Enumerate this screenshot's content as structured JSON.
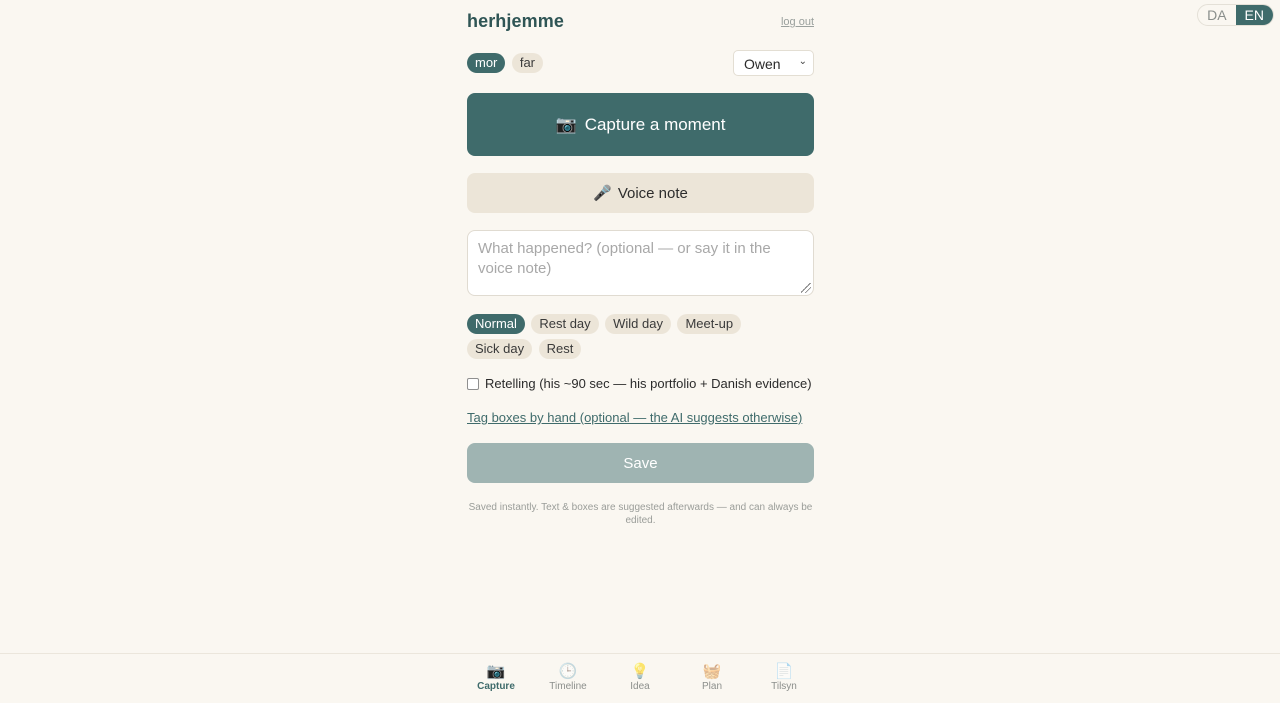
{
  "app": {
    "title": "herhjemme",
    "logout_label": "log out"
  },
  "language": {
    "options": [
      "DA",
      "EN"
    ],
    "selected": "EN"
  },
  "parent": {
    "options": [
      "mor",
      "far"
    ],
    "selected": "mor"
  },
  "child_select": {
    "value": "Owen"
  },
  "actions": {
    "capture_icon": "📷",
    "capture_label": "Capture a moment",
    "voice_icon": "🎤",
    "voice_label": "Voice note",
    "note_placeholder": "What happened? (optional — or say it in the voice note)"
  },
  "day_types": {
    "options": [
      "Normal",
      "Rest day",
      "Wild day",
      "Meet-up",
      "Sick day",
      "Rest"
    ],
    "selected": "Normal"
  },
  "retelling_label": "Retelling (his ~90 sec — his portfolio + Danish evidence)",
  "tag_link": "Tag boxes by hand (optional — the AI suggests otherwise)",
  "save_label": "Save",
  "hint": "Saved instantly. Text & boxes are suggested afterwards — and can always be edited.",
  "nav": {
    "items": [
      {
        "icon": "📷",
        "label": "Capture",
        "active": true
      },
      {
        "icon": "🕒",
        "label": "Timeline"
      },
      {
        "icon": "💡",
        "label": "Idea"
      },
      {
        "icon": "🧺",
        "label": "Plan"
      },
      {
        "icon": "📄",
        "label": "Tilsyn"
      }
    ]
  },
  "colors": {
    "accent": "#3f6b6b",
    "chip": "#ece5d8",
    "background": "#faf7f1",
    "save_disabled": "#9fb4b2"
  }
}
